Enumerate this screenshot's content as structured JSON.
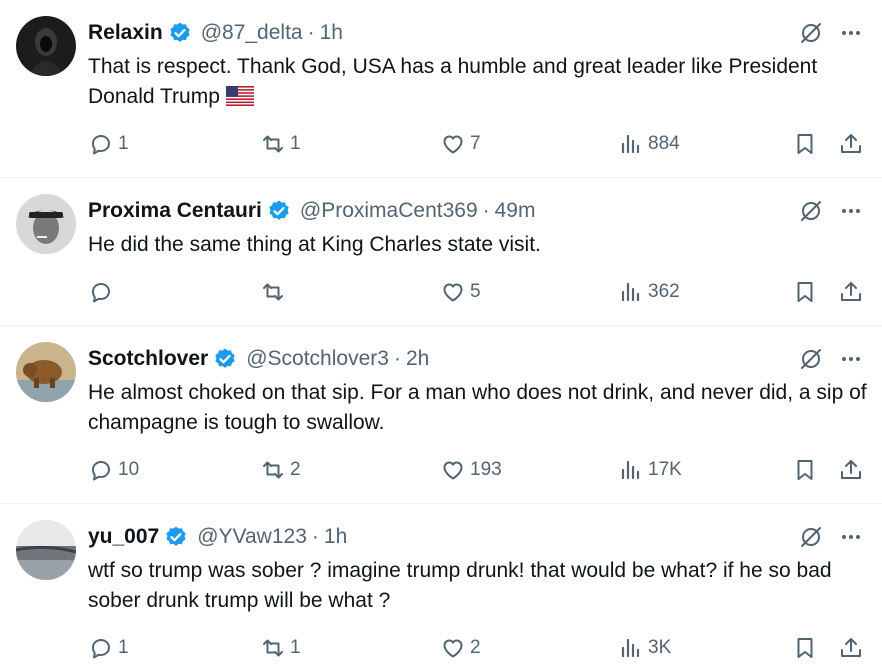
{
  "tweets": [
    {
      "name": "Relaxin",
      "handle": "@87_delta",
      "separator": "·",
      "time": "1h",
      "text": "That is respect. Thank God, USA has a humble and great leader like President Donald Trump",
      "has_flag": true,
      "replies": "1",
      "retweets": "1",
      "likes": "7",
      "views": "884"
    },
    {
      "name": "Proxima Centauri",
      "handle": "@ProximaCent369",
      "separator": "·",
      "time": "49m",
      "text": "He did the same thing at King Charles state visit.",
      "has_flag": false,
      "replies": "",
      "retweets": "",
      "likes": "5",
      "views": "362"
    },
    {
      "name": "Scotchlover",
      "handle": "@Scotchlover3",
      "separator": "·",
      "time": "2h",
      "text": "He almost choked on that sip. For a man who does not drink, and never did, a sip of champagne is tough to swallow.",
      "has_flag": false,
      "replies": "10",
      "retweets": "2",
      "likes": "193",
      "views": "17K"
    },
    {
      "name": "yu_007",
      "handle": "@YVaw123",
      "separator": "·",
      "time": "1h",
      "text": "wtf so trump was sober ? imagine trump drunk! that would be what? if he so bad sober drunk trump will be what ?",
      "has_flag": false,
      "replies": "1",
      "retweets": "1",
      "likes": "2",
      "views": "3K"
    }
  ],
  "colors": {
    "text": "#0f1419",
    "secondary": "#536471",
    "verified": "#1d9bf0",
    "divider": "#eff3f4"
  },
  "icons": [
    "verified-badge-icon",
    "grok-icon",
    "more-icon",
    "reply-icon",
    "retweet-icon",
    "like-icon",
    "views-icon",
    "bookmark-icon",
    "share-icon",
    "us-flag-emoji"
  ]
}
